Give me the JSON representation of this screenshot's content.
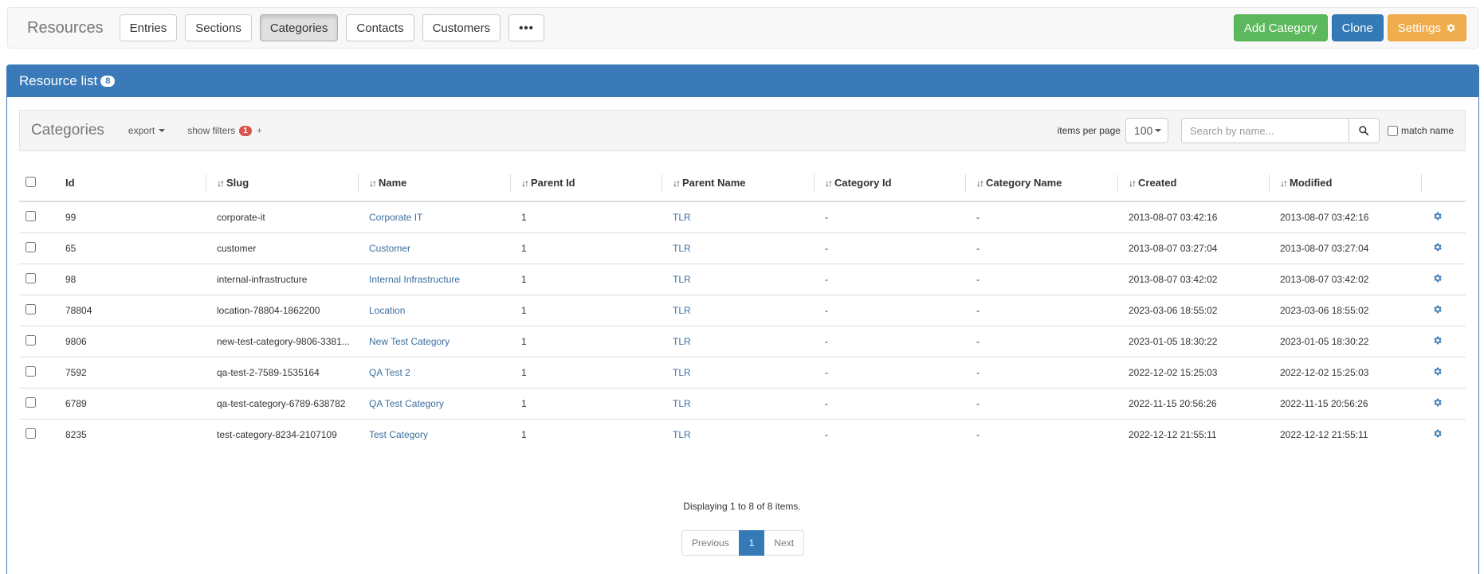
{
  "navbar": {
    "brand": "Resources",
    "tabs": [
      {
        "label": "Entries"
      },
      {
        "label": "Sections"
      },
      {
        "label": "Categories",
        "active": true
      },
      {
        "label": "Contacts"
      },
      {
        "label": "Customers"
      }
    ],
    "more_label": "•••",
    "add_label": "Add Category",
    "clone_label": "Clone",
    "settings_label": "Settings"
  },
  "panel": {
    "title": "Resource list",
    "count": "8"
  },
  "toolbar": {
    "title": "Categories",
    "export_label": "export",
    "filters_label": "show filters",
    "filters_count": "1",
    "plus": "+",
    "ipp_label": "items per page",
    "ipp_value": "100",
    "search_placeholder": "Search by name...",
    "match_label": "match name"
  },
  "table": {
    "headers": {
      "id": "Id",
      "slug": "Slug",
      "name": "Name",
      "parent_id": "Parent Id",
      "parent_name": "Parent Name",
      "category_id": "Category Id",
      "category_name": "Category Name",
      "created": "Created",
      "modified": "Modified"
    },
    "rows": [
      {
        "id": "99",
        "slug": "corporate-it",
        "name": "Corporate IT",
        "parent_id": "1",
        "parent_name": "TLR",
        "category_id": "-",
        "category_name": "-",
        "created": "2013-08-07 03:42:16",
        "modified": "2013-08-07 03:42:16"
      },
      {
        "id": "65",
        "slug": "customer",
        "name": "Customer",
        "parent_id": "1",
        "parent_name": "TLR",
        "category_id": "-",
        "category_name": "-",
        "created": "2013-08-07 03:27:04",
        "modified": "2013-08-07 03:27:04"
      },
      {
        "id": "98",
        "slug": "internal-infrastructure",
        "name": "Internal Infrastructure",
        "parent_id": "1",
        "parent_name": "TLR",
        "category_id": "-",
        "category_name": "-",
        "created": "2013-08-07 03:42:02",
        "modified": "2013-08-07 03:42:02"
      },
      {
        "id": "78804",
        "slug": "location-78804-1862200",
        "name": "Location",
        "parent_id": "1",
        "parent_name": "TLR",
        "category_id": "-",
        "category_name": "-",
        "created": "2023-03-06 18:55:02",
        "modified": "2023-03-06 18:55:02"
      },
      {
        "id": "9806",
        "slug": "new-test-category-9806-3381...",
        "name": "New Test Category",
        "parent_id": "1",
        "parent_name": "TLR",
        "category_id": "-",
        "category_name": "-",
        "created": "2023-01-05 18:30:22",
        "modified": "2023-01-05 18:30:22"
      },
      {
        "id": "7592",
        "slug": "qa-test-2-7589-1535164",
        "name": "QA Test 2",
        "parent_id": "1",
        "parent_name": "TLR",
        "category_id": "-",
        "category_name": "-",
        "created": "2022-12-02 15:25:03",
        "modified": "2022-12-02 15:25:03"
      },
      {
        "id": "6789",
        "slug": "qa-test-category-6789-638782",
        "name": "QA Test Category",
        "parent_id": "1",
        "parent_name": "TLR",
        "category_id": "-",
        "category_name": "-",
        "created": "2022-11-15 20:56:26",
        "modified": "2022-11-15 20:56:26"
      },
      {
        "id": "8235",
        "slug": "test-category-8234-2107109",
        "name": "Test Category",
        "parent_id": "1",
        "parent_name": "TLR",
        "category_id": "-",
        "category_name": "-",
        "created": "2022-12-12 21:55:11",
        "modified": "2022-12-12 21:55:11"
      }
    ]
  },
  "footer": {
    "summary": "Displaying 1 to 8 of 8 items.",
    "prev_label": "Previous",
    "current_page": "1",
    "next_label": "Next"
  },
  "colors": {
    "primary": "#337ab7",
    "success": "#5cb85c",
    "warning": "#f0ad4e",
    "danger": "#d9534f",
    "link": "#3b6fa1"
  }
}
